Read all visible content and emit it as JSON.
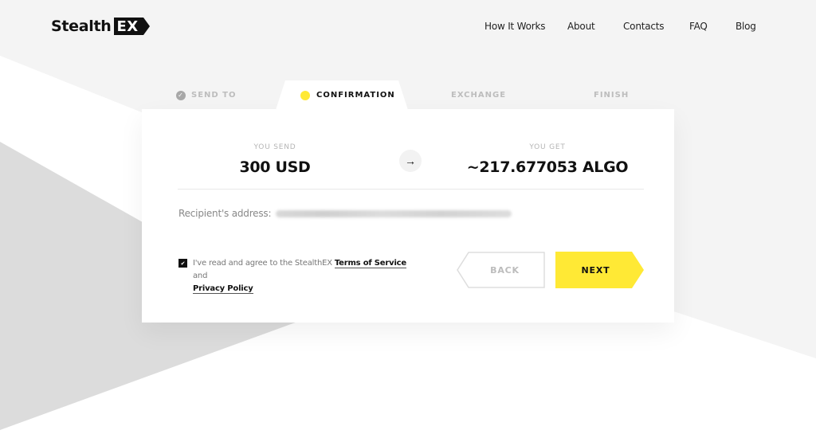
{
  "brand": {
    "name_prefix": "Stealth",
    "name_suffix": "EX"
  },
  "nav": {
    "items": [
      {
        "label": "How It Works"
      },
      {
        "label": "About"
      },
      {
        "label": "Contacts"
      },
      {
        "label": "FAQ"
      },
      {
        "label": "Blog"
      }
    ]
  },
  "steps": [
    {
      "label": "SEND TO",
      "state": "completed"
    },
    {
      "label": "CONFIRMATION",
      "state": "active"
    },
    {
      "label": "EXCHANGE",
      "state": "pending"
    },
    {
      "label": "FINISH",
      "state": "pending"
    }
  ],
  "exchange": {
    "send_label": "YOU SEND",
    "send_amount": "300 USD",
    "get_label": "YOU GET",
    "get_amount": "~217.677053 ALGO",
    "arrow_icon": "arrow-right-icon"
  },
  "recipient": {
    "label": "Recipient's address:",
    "address_hidden": true
  },
  "agreement": {
    "checked": true,
    "text_before": "I've read and agree to the StealthEX ",
    "terms_link": "Terms of Service",
    "text_middle": " and ",
    "privacy_link": "Privacy Policy"
  },
  "buttons": {
    "back_label": "BACK",
    "next_label": "NEXT"
  },
  "colors": {
    "accent": "#ffe935",
    "dark": "#111111",
    "muted": "#bdbdbd",
    "bg_light": "#f4f4f4",
    "bg_grey": "#dcdcdc"
  }
}
